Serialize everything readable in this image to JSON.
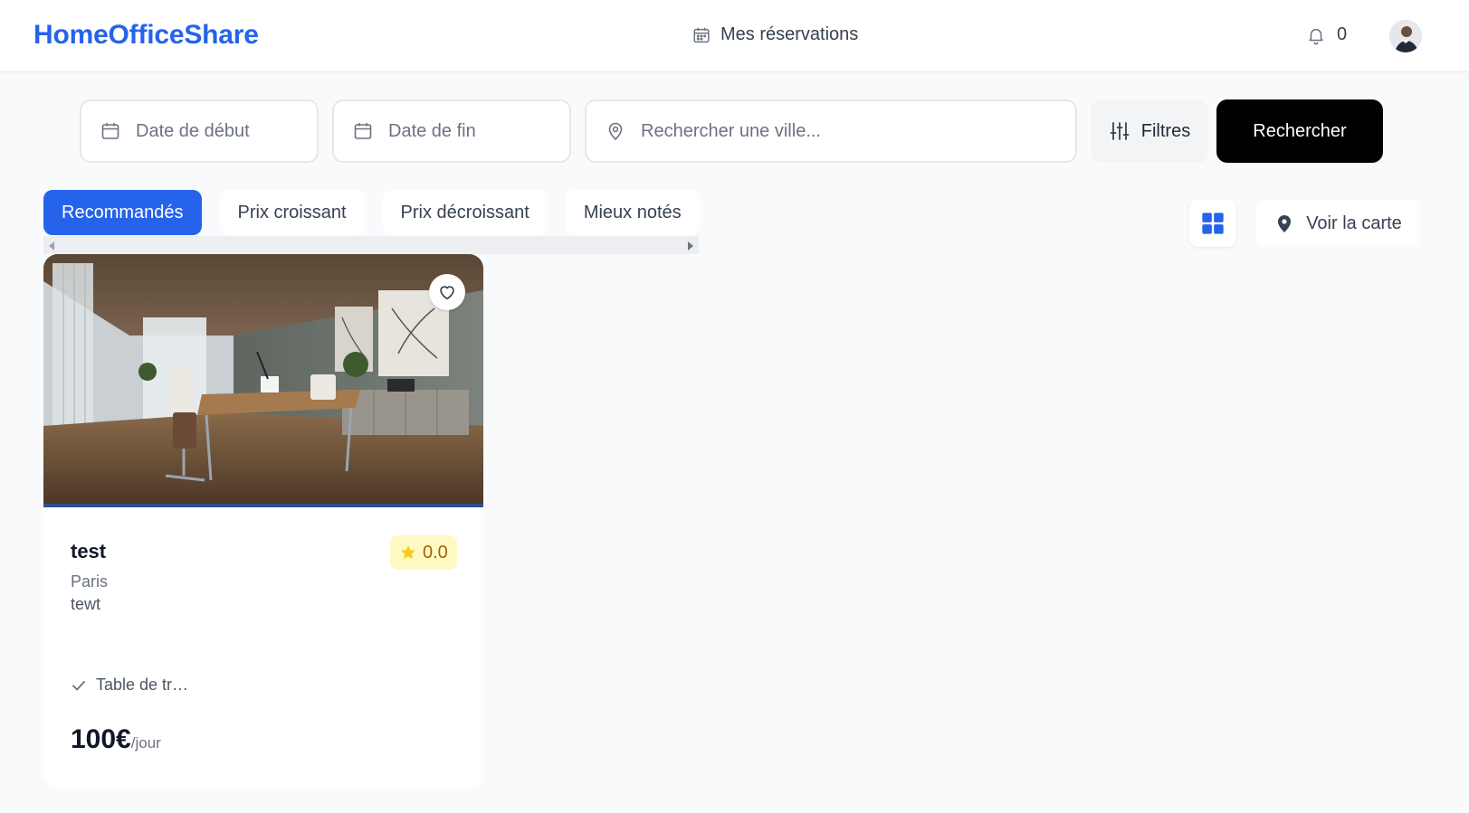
{
  "header": {
    "brand": "HomeOfficeShare",
    "reservations_label": "Mes réservations",
    "notifications_count": "0"
  },
  "search": {
    "start_placeholder": "Date de début",
    "end_placeholder": "Date de fin",
    "city_placeholder": "Rechercher une ville...",
    "filters_label": "Filtres",
    "search_label": "Rechercher"
  },
  "sort": {
    "options": [
      {
        "label": "Recommandés",
        "active": true
      },
      {
        "label": "Prix croissant",
        "active": false
      },
      {
        "label": "Prix décroissant",
        "active": false
      },
      {
        "label": "Mieux notés",
        "active": false
      }
    ]
  },
  "view": {
    "map_label": "Voir la carte"
  },
  "listings": [
    {
      "title": "test",
      "rating": "0.0",
      "city": "Paris",
      "description": "tewt",
      "amenity": "Table de tr…",
      "price": "100€",
      "price_unit": "/jour"
    }
  ],
  "colors": {
    "accent": "#2563eb",
    "search_button": "#000000",
    "rating_bg": "#fef9c3",
    "rating_star": "#facc15"
  },
  "icons": {
    "reservations": "calendar-icon",
    "notifications": "bell-icon",
    "date": "calendar-icon",
    "city": "map-pin-icon",
    "filters": "sliders-icon",
    "grid_view": "grid-icon",
    "map": "map-pin-filled-icon",
    "favorite": "heart-icon",
    "rating": "star-icon",
    "amenity": "check-icon"
  }
}
